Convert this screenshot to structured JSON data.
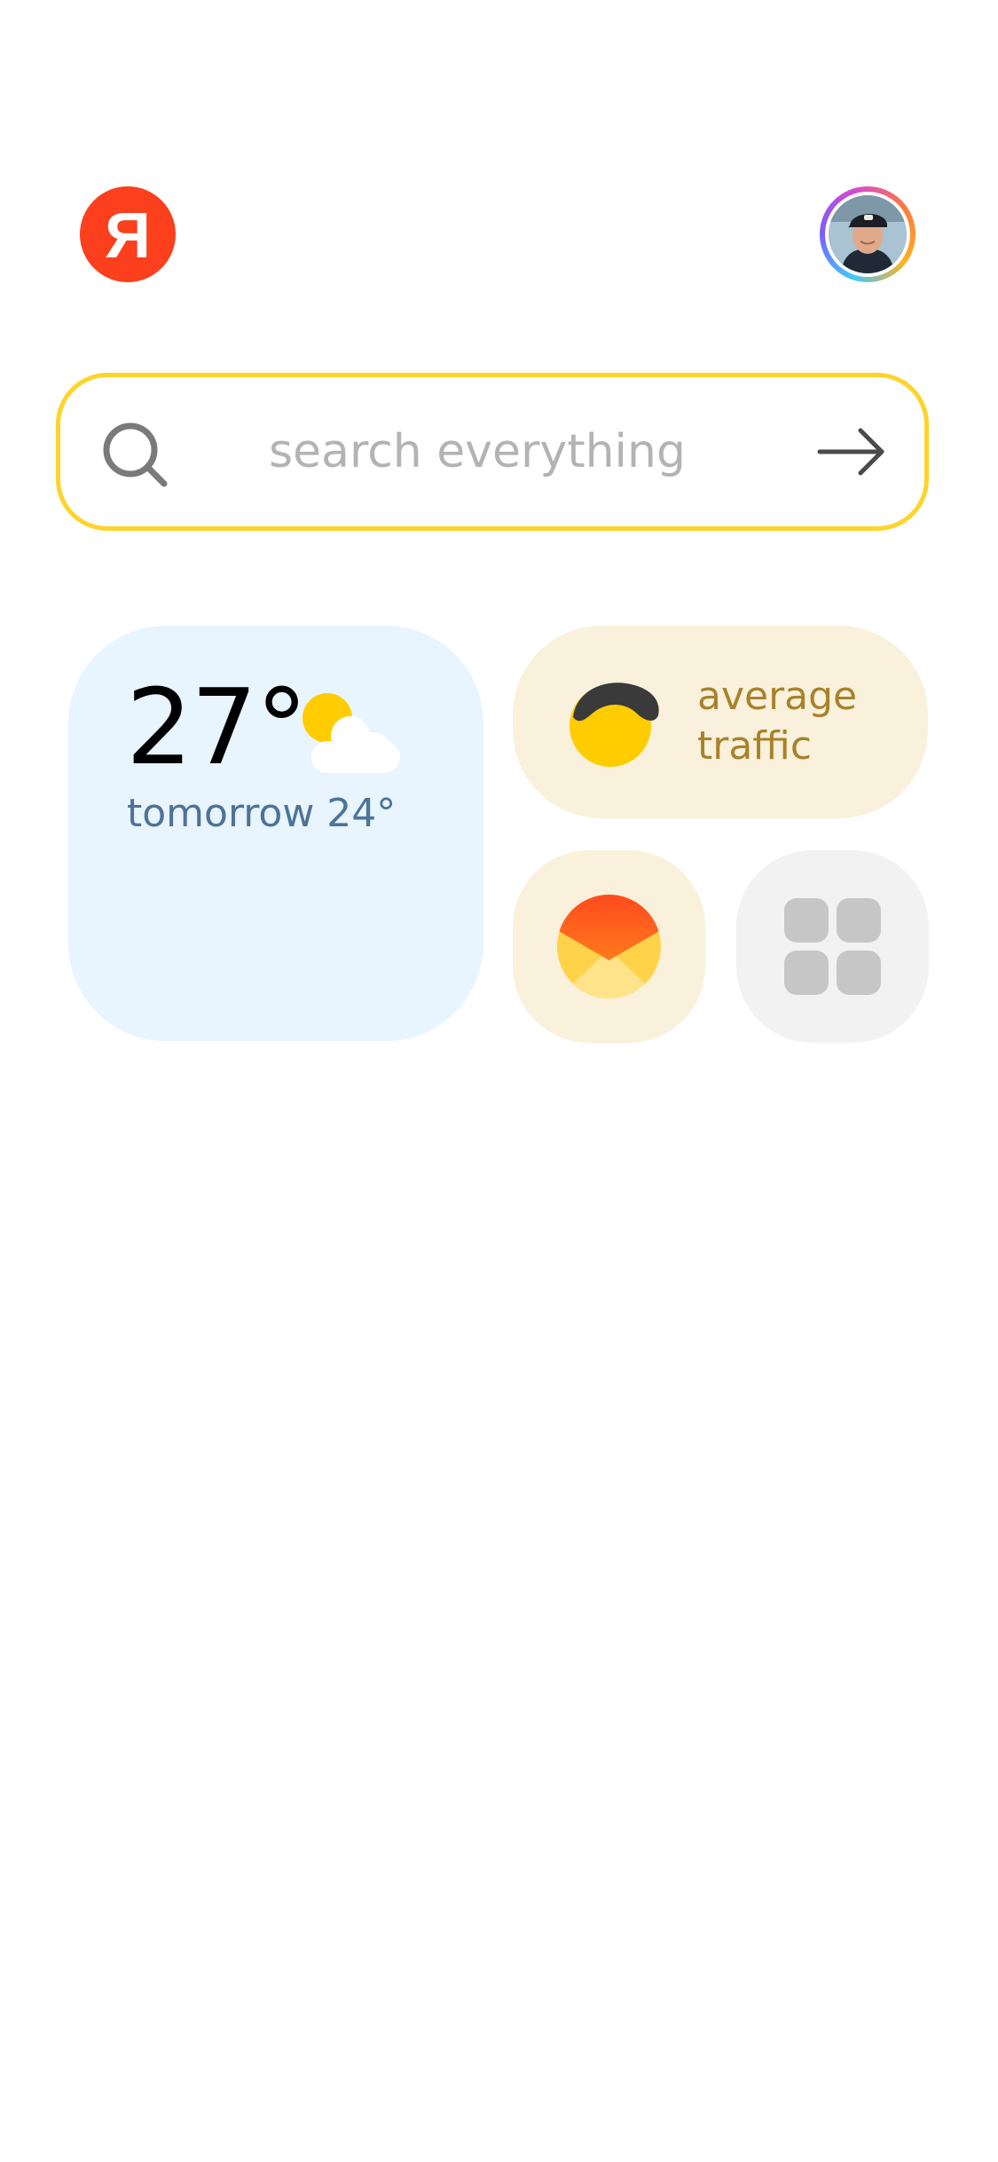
{
  "header": {
    "logo_letter": "Я",
    "logo_color": "#fc3f1d",
    "avatar_icon": "user-avatar-photo"
  },
  "search": {
    "placeholder": "search everything",
    "value": "",
    "border_color": "#fed42b",
    "search_icon": "search-icon",
    "submit_icon": "arrow-right-icon"
  },
  "widgets": {
    "weather": {
      "temperature": "27°",
      "tomorrow": "tomorrow 24°",
      "icon": "partly-cloudy-icon",
      "background": "#e8f4fe"
    },
    "traffic": {
      "label": "average traffic",
      "icon": "traffic-indicator-icon",
      "background": "#faf1dc"
    },
    "mail": {
      "icon": "mail-envelope-icon",
      "background": "#faf1dc"
    },
    "services": {
      "icon": "app-grid-icon",
      "background": "#f2f2f2"
    }
  }
}
